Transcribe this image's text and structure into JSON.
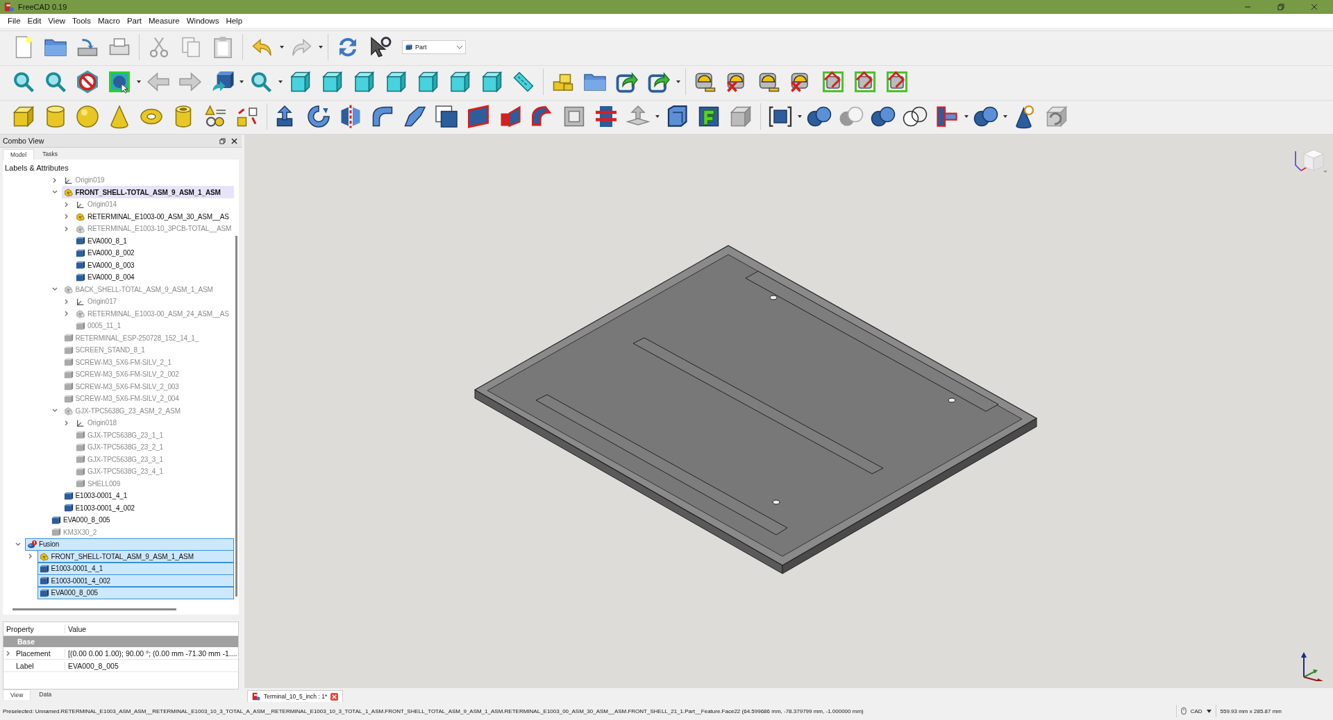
{
  "window": {
    "title": "FreeCAD 0.19"
  },
  "menu": [
    "File",
    "Edit",
    "View",
    "Tools",
    "Macro",
    "Part",
    "Measure",
    "Windows",
    "Help"
  ],
  "workbench_selector": {
    "value": "Part"
  },
  "combo_view": {
    "title": "Combo View",
    "tabs": [
      {
        "label": "Model",
        "selected": true
      },
      {
        "label": "Tasks",
        "selected": false
      }
    ],
    "tree_header": "Labels & Attributes",
    "tree": [
      {
        "children": [
          {
            "children": [
              {
                "children": [
                  {
                    "label": "Origin019",
                    "kind": "origin",
                    "visible": false,
                    "expanded": false,
                    "selected": false,
                    "active": false
                  },
                  {
                    "label": "FRONT_SHELL-TOTAL_ASM_9_ASM_1_ASM",
                    "kind": "assembly",
                    "visible": true,
                    "expanded": true,
                    "selected": false,
                    "active": true,
                    "children": [
                      {
                        "label": "Origin014",
                        "kind": "origin",
                        "visible": false,
                        "expanded": false,
                        "selected": false,
                        "active": false
                      },
                      {
                        "label": "RETERMINAL_E1003-00_ASM_30_ASM__AS",
                        "kind": "assembly",
                        "visible": true,
                        "expanded": false,
                        "selected": false,
                        "active": false
                      },
                      {
                        "label": "RETERMINAL_E1003-10_3PCB-TOTAL__ASM",
                        "kind": "assembly",
                        "visible": false,
                        "expanded": false,
                        "selected": false,
                        "active": false
                      },
                      {
                        "label": "EVA000_8_1",
                        "kind": "body",
                        "visible": true,
                        "selected": false,
                        "active": false
                      },
                      {
                        "label": "EVA000_8_002",
                        "kind": "body",
                        "visible": true,
                        "selected": false,
                        "active": false
                      },
                      {
                        "label": "EVA000_8_003",
                        "kind": "body",
                        "visible": true,
                        "selected": false,
                        "active": false
                      },
                      {
                        "label": "EVA000_8_004",
                        "kind": "body",
                        "visible": true,
                        "selected": false,
                        "active": false
                      }
                    ]
                  },
                  {
                    "label": "BACK_SHELL-TOTAL_ASM_9_ASM_1_ASM",
                    "kind": "assembly",
                    "visible": false,
                    "expanded": true,
                    "selected": false,
                    "active": false,
                    "children": [
                      {
                        "label": "Origin017",
                        "kind": "origin",
                        "visible": false,
                        "expanded": false,
                        "selected": false,
                        "active": false
                      },
                      {
                        "label": "RETERMINAL_E1003-00_ASM_24_ASM__AS",
                        "kind": "assembly",
                        "visible": false,
                        "expanded": false,
                        "selected": false,
                        "active": false
                      },
                      {
                        "label": "0005_11_1",
                        "kind": "body",
                        "visible": false,
                        "selected": false,
                        "active": false
                      }
                    ]
                  },
                  {
                    "label": "RETERMINAL_ESP-250728_152_14_1_",
                    "kind": "body",
                    "visible": false,
                    "selected": false,
                    "active": false
                  },
                  {
                    "label": "SCREEN_STAND_8_1",
                    "kind": "body",
                    "visible": false,
                    "selected": false,
                    "active": false
                  },
                  {
                    "label": "SCREW-M3_5X6-FM-SILV_2_1",
                    "kind": "body",
                    "visible": false,
                    "selected": false,
                    "active": false
                  },
                  {
                    "label": "SCREW-M3_5X6-FM-SILV_2_002",
                    "kind": "body",
                    "visible": false,
                    "selected": false,
                    "active": false
                  },
                  {
                    "label": "SCREW-M3_5X6-FM-SILV_2_003",
                    "kind": "body",
                    "visible": false,
                    "selected": false,
                    "active": false
                  },
                  {
                    "label": "SCREW-M3_5X6-FM-SILV_2_004",
                    "kind": "body",
                    "visible": false,
                    "selected": false,
                    "active": false
                  },
                  {
                    "label": "GJX-TPC5638G_23_ASM_2_ASM",
                    "kind": "assembly",
                    "visible": false,
                    "expanded": true,
                    "selected": false,
                    "active": false,
                    "children": [
                      {
                        "label": "Origin018",
                        "kind": "origin",
                        "visible": false,
                        "expanded": false,
                        "selected": false,
                        "active": false
                      },
                      {
                        "label": "GJX-TPC5638G_23_1_1",
                        "kind": "body",
                        "visible": false,
                        "selected": false,
                        "active": false
                      },
                      {
                        "label": "GJX-TPC5638G_23_2_1",
                        "kind": "body",
                        "visible": false,
                        "selected": false,
                        "active": false
                      },
                      {
                        "label": "GJX-TPC5638G_23_3_1",
                        "kind": "body",
                        "visible": false,
                        "selected": false,
                        "active": false
                      },
                      {
                        "label": "GJX-TPC5638G_23_4_1",
                        "kind": "body",
                        "visible": false,
                        "selected": false,
                        "active": false
                      },
                      {
                        "label": "SHELL009",
                        "kind": "body",
                        "visible": false,
                        "selected": false,
                        "active": false
                      }
                    ]
                  },
                  {
                    "label": "E1003-0001_4_1",
                    "kind": "body",
                    "visible": true,
                    "selected": false,
                    "active": false
                  },
                  {
                    "label": "E1003-0001_4_002",
                    "kind": "body",
                    "visible": true,
                    "selected": false,
                    "active": false
                  }
                ]
              },
              {
                "label": "EVA000_8_005",
                "kind": "body",
                "visible": true,
                "selected": false,
                "active": false
              },
              {
                "label": "KM3X30_2",
                "kind": "body",
                "visible": false,
                "selected": false,
                "active": false
              }
            ]
          }
        ]
      },
      {
        "label": "Fusion",
        "kind": "fusion",
        "visible": true,
        "expanded": true,
        "selected": true,
        "active": false,
        "children": [
          {
            "label": "FRONT_SHELL-TOTAL_ASM_9_ASM_1_ASM",
            "kind": "assembly",
            "visible": true,
            "expanded": false,
            "selected": true,
            "active": false
          },
          {
            "label": "E1003-0001_4_1",
            "kind": "body",
            "visible": true,
            "selected": true,
            "active": false
          },
          {
            "label": "E1003-0001_4_002",
            "kind": "body",
            "visible": true,
            "selected": true,
            "active": false
          },
          {
            "label": "EVA000_8_005",
            "kind": "body",
            "visible": true,
            "selected": true,
            "active": false
          }
        ]
      }
    ]
  },
  "property_panel": {
    "columns": [
      "Property",
      "Value"
    ],
    "groups": [
      {
        "name": "Base",
        "rows": [
          {
            "name": "Placement",
            "value": "[(0.00 0.00 1.00); 90.00 °; (0.00 mm  -71.30 mm  -1....",
            "expanded": false
          },
          {
            "name": "Label",
            "value": "EVA000_8_005"
          }
        ]
      }
    ],
    "tabs": [
      {
        "label": "View",
        "selected": true
      },
      {
        "label": "Data",
        "selected": false
      }
    ]
  },
  "document_tabs": [
    {
      "label": "Terminal_10_5_inch : 1*"
    }
  ],
  "status_bar": {
    "message": "Preselected: Unnamed.RETERMINAL_E1003_ASM_ASM__RETERMINAL_E1003_10_3_TOTAL_A_ASM__RETERMINAL_E1003_10_3_TOTAL_1_ASM.FRONT_SHELL_TOTAL_ASM_9_ASM_1_ASM.RETERMINAL_E1003_00_ASM_30_ASM__ASM.FRONT_SHELL_21_1.Part__Feature.Face22 (64.599686 mm, -78.379799 mm, -1.000000 mm)",
    "navigation_style": "CAD",
    "dimensions": "559.93 mm x 285.87 mm"
  }
}
